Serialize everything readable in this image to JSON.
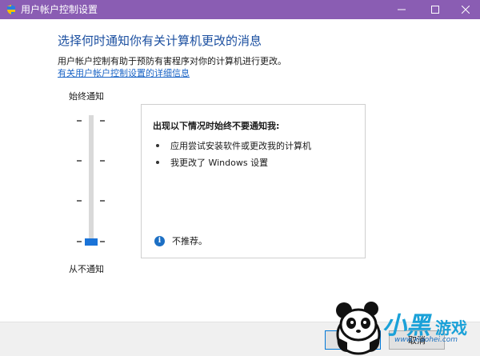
{
  "window": {
    "title": "用户帐户控制设置",
    "min_icon": "minimize-icon",
    "max_icon": "maximize-icon",
    "close_icon": "close-icon"
  },
  "main": {
    "heading": "选择何时通知你有关计算机更改的消息",
    "description": "用户帐户控制有助于预防有害程序对你的计算机进行更改。",
    "link": "有关用户帐户控制设置的详细信息"
  },
  "slider": {
    "top_label": "始终通知",
    "bottom_label": "从不通知",
    "level": 0,
    "levels": 4
  },
  "panel": {
    "title": "出现以下情况时始终不要通知我:",
    "items": [
      "应用尝试安装软件或更改我的计算机",
      "我更改了 Windows 设置"
    ],
    "info_text": "不推荐。"
  },
  "footer": {
    "ok_label": "确定",
    "cancel_label": "取消"
  },
  "watermark": {
    "logo_text": "小黑",
    "logo_sub": "游戏",
    "url": "www.xiaohei.com"
  },
  "colors": {
    "titlebar": "#8a5db3",
    "heading": "#1b4fa0",
    "link": "#1a64c6",
    "thumb": "#1a73d8"
  }
}
